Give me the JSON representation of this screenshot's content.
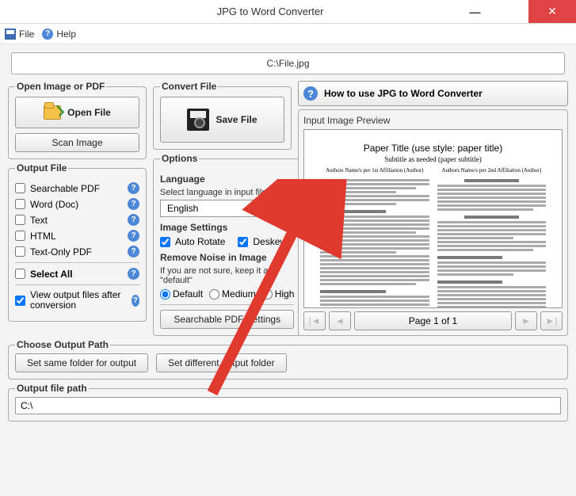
{
  "window": {
    "title": "JPG to Word Converter"
  },
  "menu": {
    "file": "File",
    "help": "Help"
  },
  "filepath": "C:\\File.jpg",
  "open_group": {
    "legend": "Open Image or PDF",
    "open_btn": "Open File",
    "scan_btn": "Scan Image"
  },
  "convert_group": {
    "legend": "Convert File",
    "save_btn": "Save File"
  },
  "output_group": {
    "legend": "Output File",
    "items": [
      {
        "label": "Searchable PDF",
        "checked": false
      },
      {
        "label": "Word (Doc)",
        "checked": false
      },
      {
        "label": "Text",
        "checked": false
      },
      {
        "label": "HTML",
        "checked": false
      },
      {
        "label": "Text-Only PDF",
        "checked": false
      }
    ],
    "select_all": {
      "label": "Select All",
      "checked": false
    },
    "view_after": {
      "label": "View output files after conversion",
      "checked": true
    }
  },
  "options_group": {
    "legend": "Options",
    "language_label": "Language",
    "language_hint": "Select language in input file",
    "language_value": "English",
    "image_settings_label": "Image Settings",
    "auto_rotate": {
      "label": "Auto Rotate",
      "checked": true
    },
    "deskew": {
      "label": "Deskew",
      "checked": true
    },
    "noise_label": "Remove Noise in Image",
    "noise_hint": "If you are not sure, keep it as \"default\"",
    "noise_options": [
      "Default",
      "Medium",
      "High"
    ],
    "noise_selected": "Default",
    "pdf_settings_btn": "Searchable PDF Settings"
  },
  "howto_btn": "How to use JPG to Word Converter",
  "preview": {
    "label": "Input Image Preview",
    "doc_title": "Paper Title (use style: paper title)",
    "doc_subtitle": "Subtitle as needed (paper subtitle)",
    "author_a": "Authors Name/s per 1st Affiliation (Author)",
    "author_b": "Authors Name/s per 2nd Affiliation (Author)"
  },
  "pager": {
    "label": "Page 1 of 1"
  },
  "choose_path": {
    "legend": "Choose Output Path",
    "same_btn": "Set same folder for output",
    "diff_btn": "Set different output folder"
  },
  "out_path": {
    "label": "Output file path",
    "value": "C:\\"
  }
}
